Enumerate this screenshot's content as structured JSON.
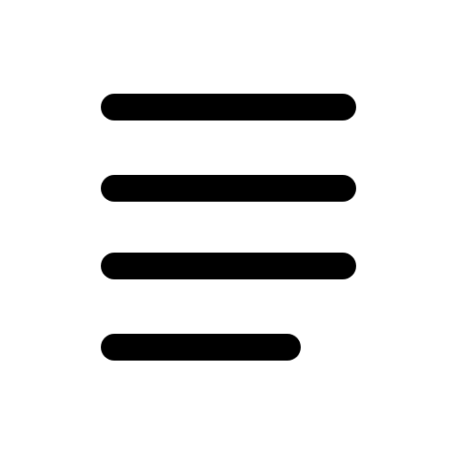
{
  "icon": {
    "name": "text-align-left-icon",
    "stroke_color": "#000000",
    "background_color": "#ffffff",
    "line_count": 4
  }
}
